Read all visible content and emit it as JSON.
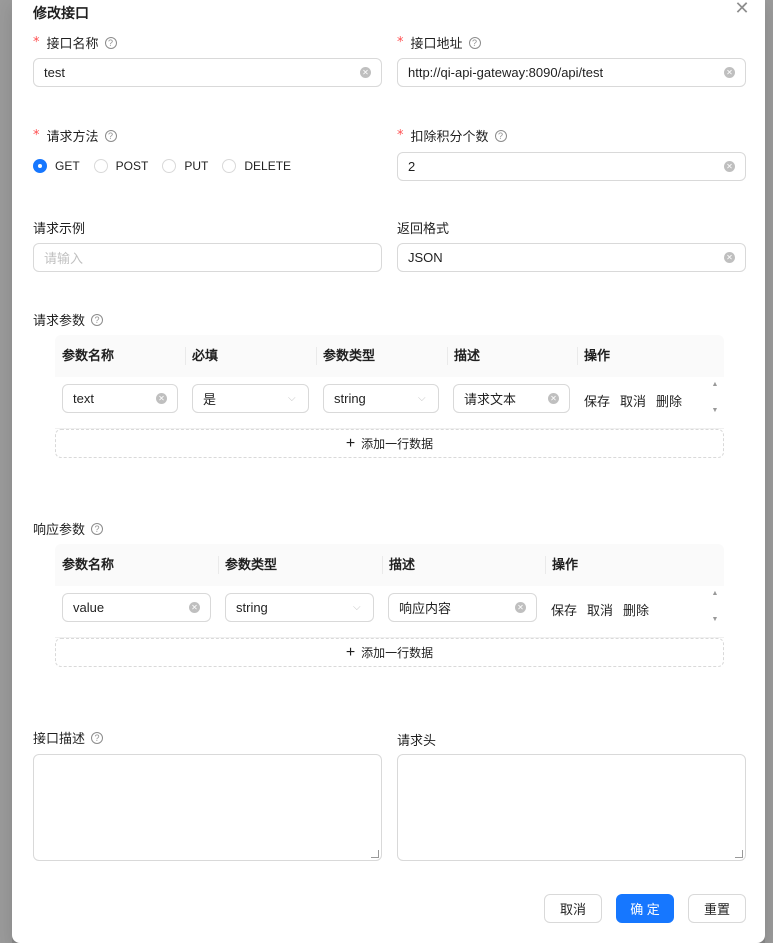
{
  "modal": {
    "title": "修改接口",
    "close_glyph": "✕"
  },
  "form": {
    "name": {
      "label": "接口名称",
      "required": true,
      "value": "test"
    },
    "url": {
      "label": "接口地址",
      "required": true,
      "value": "http://qi-api-gateway:8090/api/test"
    },
    "method": {
      "label": "请求方法",
      "required": true,
      "options": [
        "GET",
        "POST",
        "PUT",
        "DELETE"
      ],
      "selected": "GET"
    },
    "points": {
      "label": "扣除积分个数",
      "required": true,
      "value": "2"
    },
    "example": {
      "label": "请求示例",
      "placeholder": "请输入",
      "value": ""
    },
    "format": {
      "label": "返回格式",
      "value": "JSON"
    },
    "description": {
      "label": "接口描述",
      "value": ""
    },
    "headers": {
      "label": "请求头",
      "value": ""
    }
  },
  "request_params": {
    "label": "请求参数",
    "columns": [
      "参数名称",
      "必填",
      "参数类型",
      "描述",
      "操作"
    ],
    "rows": [
      {
        "name": "text",
        "required": "是",
        "type": "string",
        "desc": "请求文本"
      }
    ],
    "actions": [
      "保存",
      "取消",
      "删除"
    ],
    "add_label": "添加一行数据"
  },
  "response_params": {
    "label": "响应参数",
    "columns": [
      "参数名称",
      "参数类型",
      "描述",
      "操作"
    ],
    "rows": [
      {
        "name": "value",
        "type": "string",
        "desc": "响应内容"
      }
    ],
    "actions": [
      "保存",
      "取消",
      "删除"
    ],
    "add_label": "添加一行数据"
  },
  "footer": {
    "cancel": "取消",
    "confirm": "确 定",
    "reset": "重置"
  },
  "colors": {
    "primary": "#1677ff",
    "required_mark": "#ff4d4f"
  }
}
